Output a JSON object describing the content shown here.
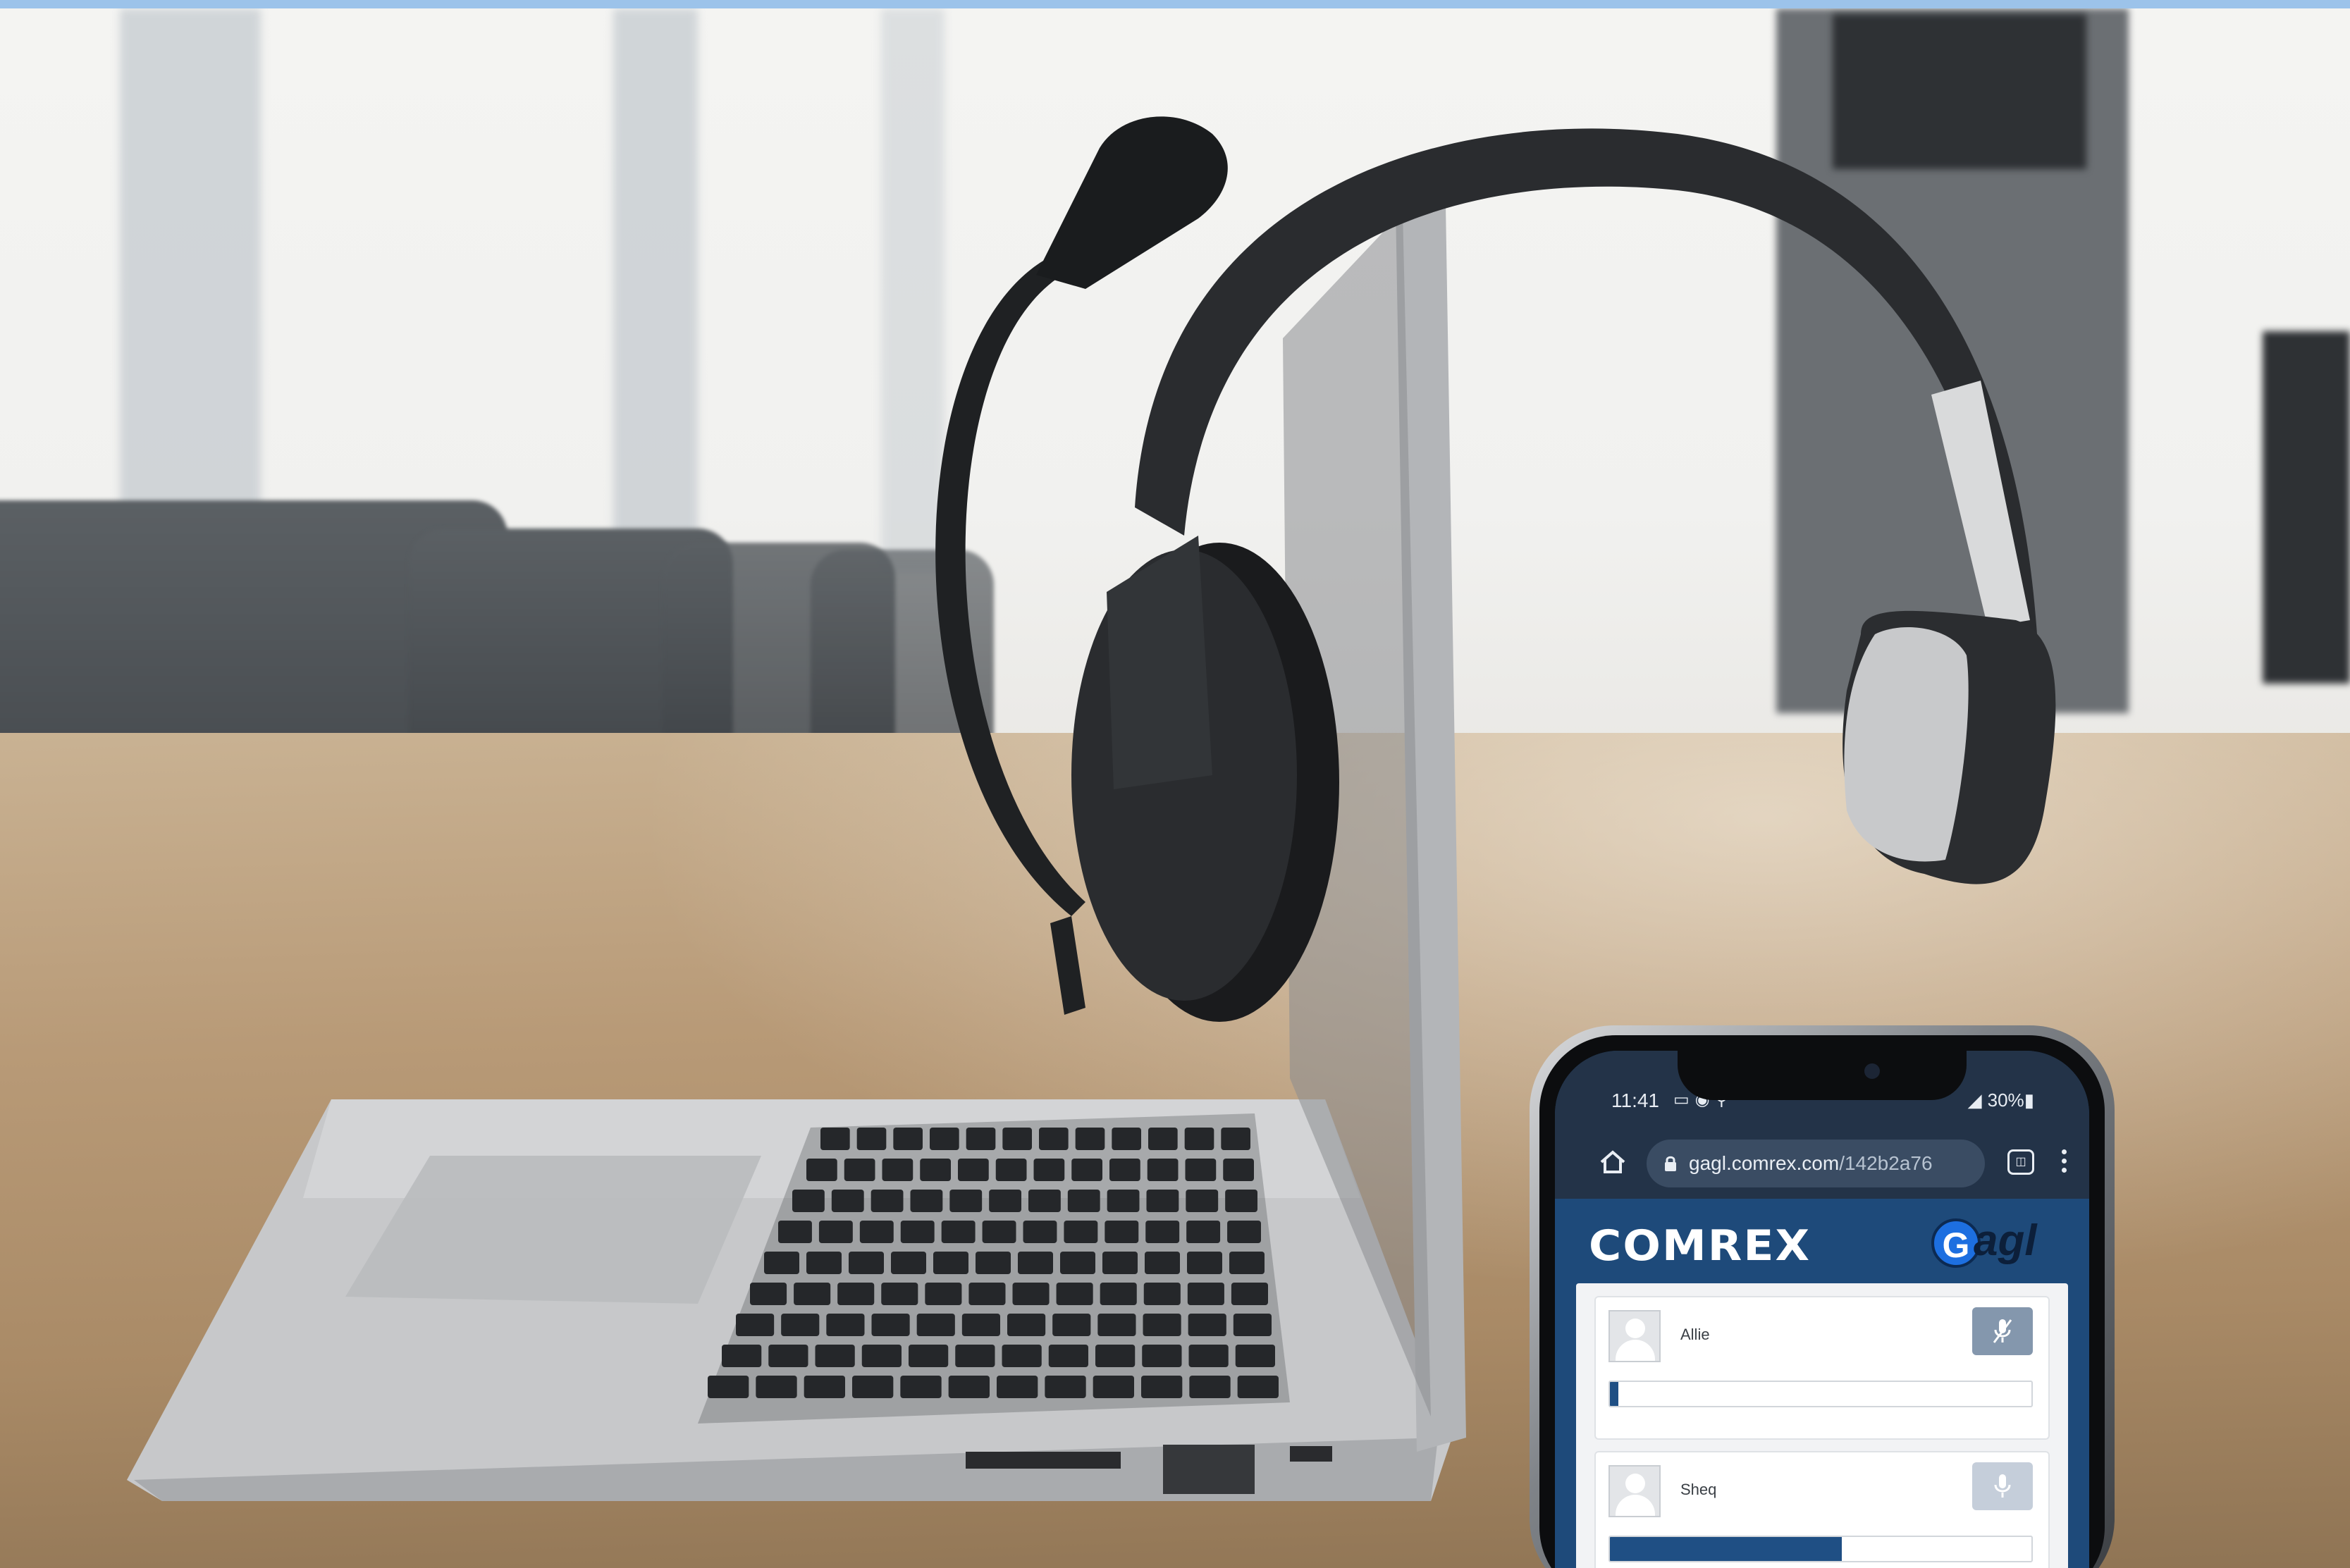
{
  "scene": {
    "colors": {
      "accent_bar": "#9cc3ea",
      "app_blue": "#1e4a7a",
      "status_bar": "#233348"
    }
  },
  "phone": {
    "status": {
      "time": "11:41",
      "battery": "30%"
    },
    "browser": {
      "url_domain": "gagl.comrex.com",
      "url_path": "/142b2a76",
      "tab_count_icon": "tabs-icon"
    },
    "app": {
      "brand": "COMREX",
      "product_initial": "G",
      "product_rest": "agl"
    },
    "participants": [
      {
        "name": "Allie",
        "mic": "muted",
        "level": 0.02
      },
      {
        "name": "Sheq",
        "mic": "muted",
        "level": 0.55
      }
    ]
  }
}
